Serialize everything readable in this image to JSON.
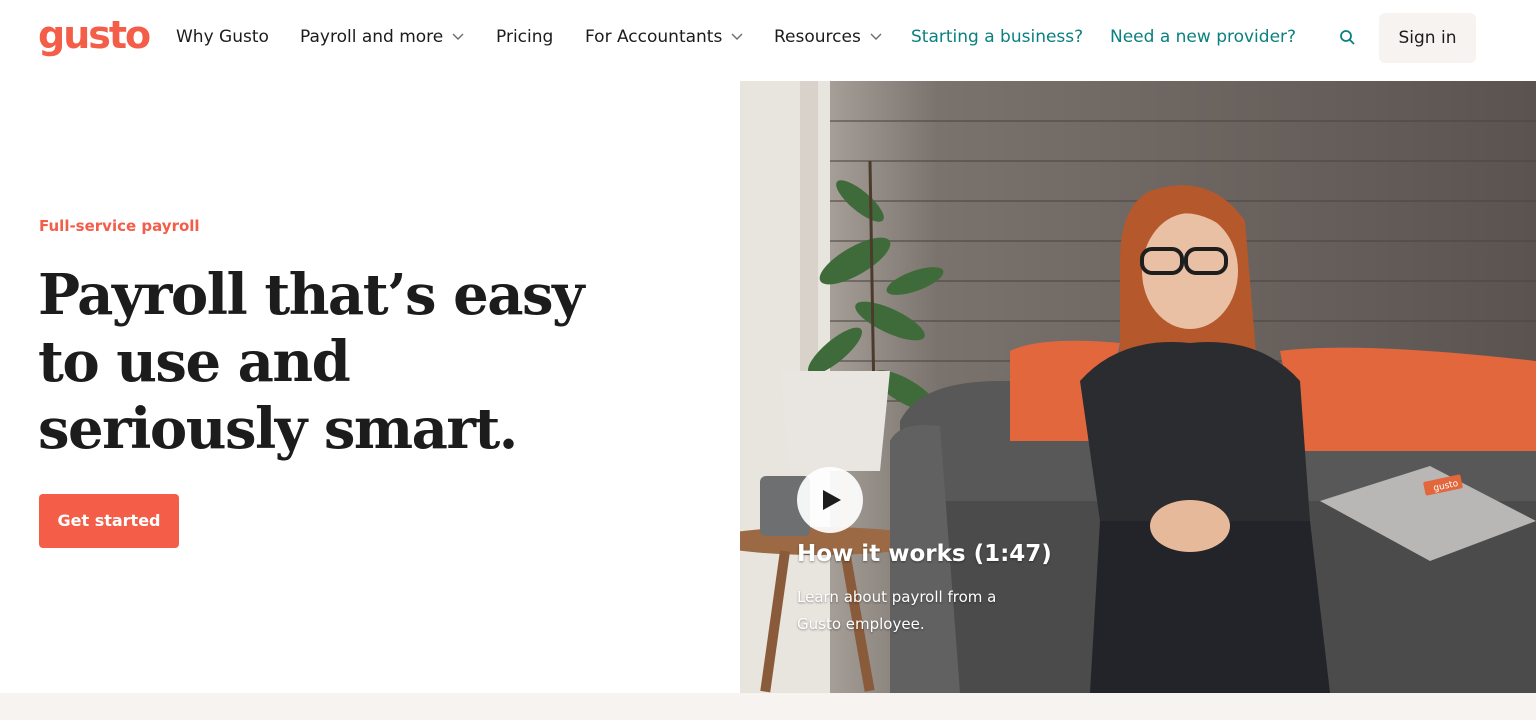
{
  "brand": {
    "logo_text": "gusto",
    "accent": "#f45d48",
    "teal": "#0a8080"
  },
  "nav": {
    "items": [
      {
        "label": "Why Gusto",
        "dropdown": false
      },
      {
        "label": "Payroll and more",
        "dropdown": true
      },
      {
        "label": "Pricing",
        "dropdown": false
      },
      {
        "label": "For Accountants",
        "dropdown": true
      },
      {
        "label": "Resources",
        "dropdown": true
      },
      {
        "label": "Starting a business?",
        "dropdown": false
      },
      {
        "label": "Need a new provider?",
        "dropdown": false
      }
    ],
    "search_icon": "search-icon",
    "sign_in": "Sign in"
  },
  "hero": {
    "eyebrow": "Full-service payroll",
    "headline": "Payroll that’s easy to use and seriously smart.",
    "cta": "Get started"
  },
  "video": {
    "play_icon": "play-icon",
    "title": "How it works (1:47)",
    "description": "Learn about payroll from a Gusto employee.",
    "laptop_sticker": "gusto"
  }
}
